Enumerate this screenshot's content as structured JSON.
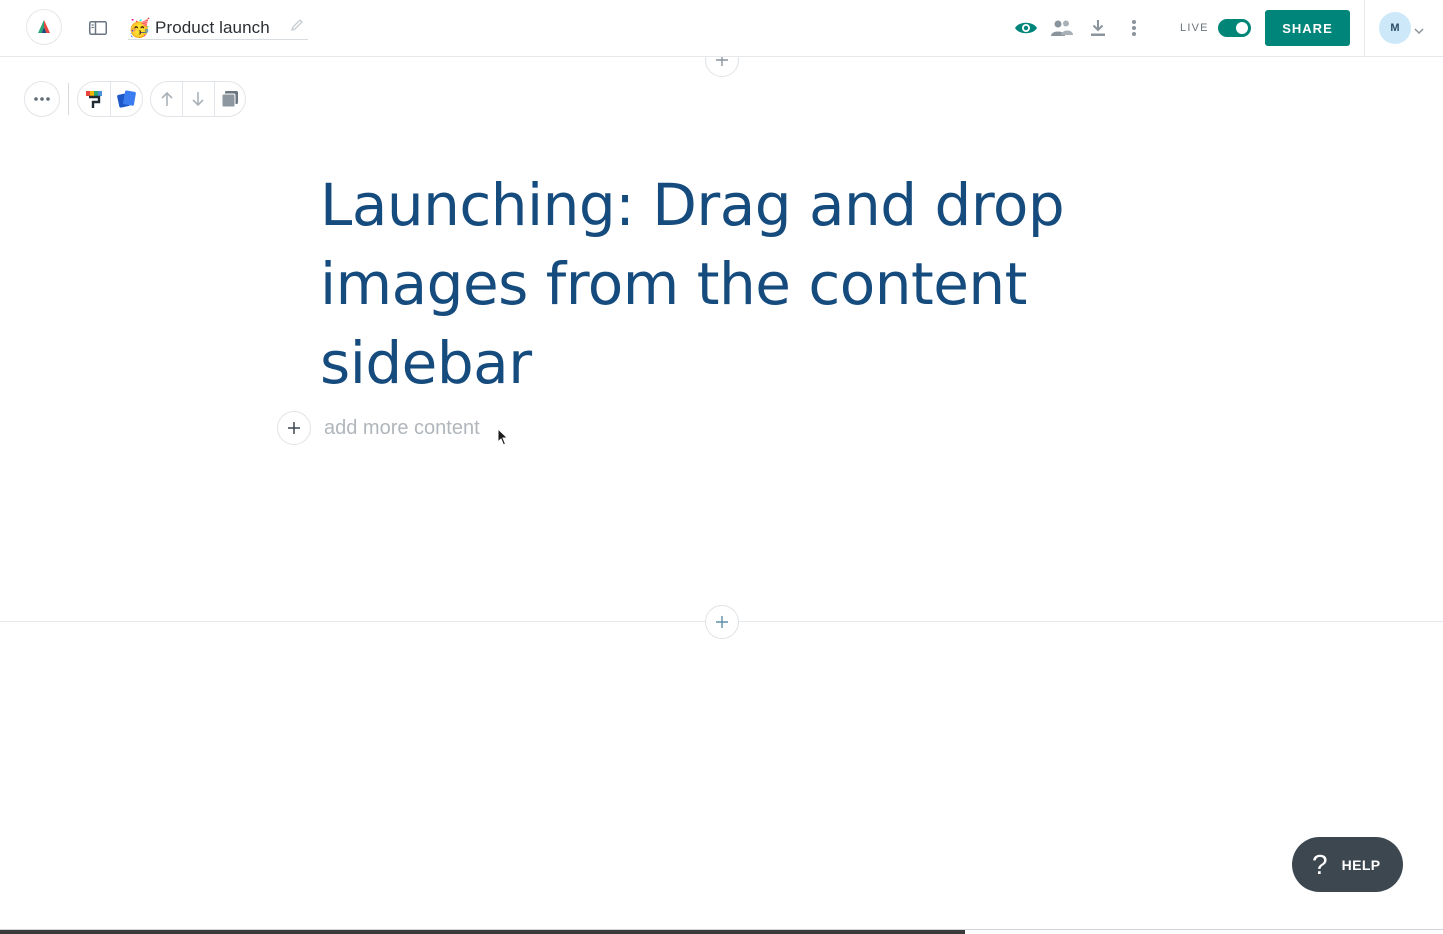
{
  "header": {
    "doc_emoji": "🥳",
    "doc_title": "Product launch",
    "live_label": "LIVE",
    "live_enabled": true,
    "share_label": "SHARE",
    "avatar_initial": "M"
  },
  "icons": {
    "logo": "app-logo-icon",
    "sidebar": "sidebar-toggle-icon",
    "edit": "pencil-icon",
    "preview": "eye-icon",
    "collaborators": "people-icon",
    "download": "download-icon",
    "more": "more-vertical-icon"
  },
  "block_toolbar": {
    "items": [
      "more-icon",
      "style-icon",
      "cards-icon",
      "move-up-icon",
      "move-down-icon",
      "duplicate-icon"
    ]
  },
  "content": {
    "headline": "Launching: Drag and drop images from the content sidebar",
    "add_more_placeholder": "add more content"
  },
  "help": {
    "label": "HELP",
    "glyph": "?"
  },
  "colors": {
    "accent": "#00857a",
    "headline": "#154b7d",
    "help_bg": "#3d4750"
  }
}
